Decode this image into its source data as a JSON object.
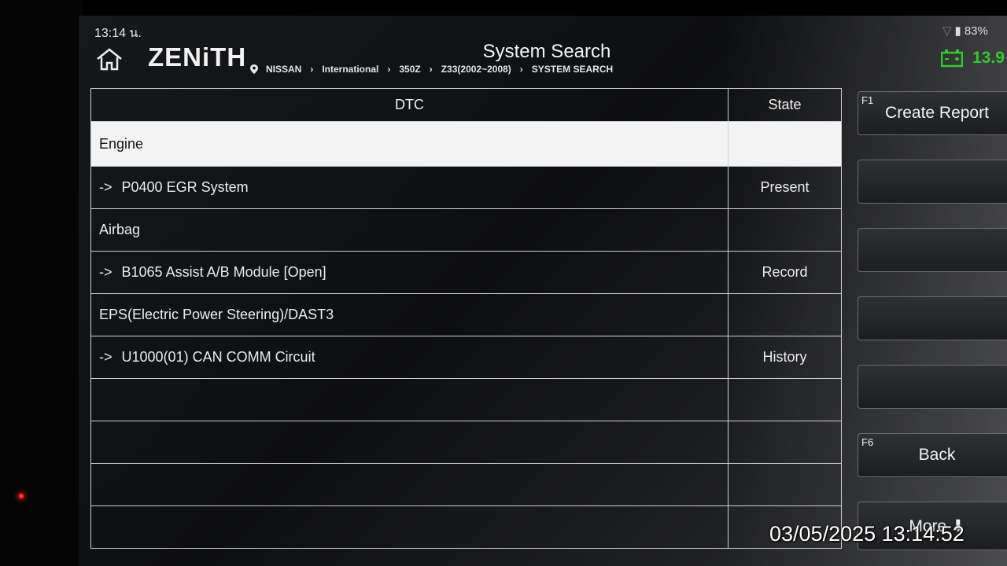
{
  "status": {
    "time": "13:14 น.",
    "battery": "83%"
  },
  "header": {
    "logo": "ZENiTH",
    "title": "System Search",
    "breadcrumb": [
      "NISSAN",
      "International",
      "350Z",
      "Z33(2002~2008)",
      "SYSTEM SEARCH"
    ],
    "voltage": "13.9"
  },
  "table": {
    "headers": {
      "dtc": "DTC",
      "state": "State"
    },
    "rows": [
      {
        "type": "group",
        "label": "Engine",
        "state": ""
      },
      {
        "type": "code",
        "label": "P0400 EGR System",
        "state": "Present"
      },
      {
        "type": "group",
        "label": "Airbag",
        "state": ""
      },
      {
        "type": "code",
        "label": "B1065 Assist A/B Module [Open]",
        "state": "Record"
      },
      {
        "type": "group",
        "label": "EPS(Electric Power Steering)/DAST3",
        "state": ""
      },
      {
        "type": "code",
        "label": "U1000(01) CAN COMM Circuit",
        "state": "History"
      }
    ],
    "arrow": "->"
  },
  "fkeys": {
    "f1": {
      "num": "F1",
      "label": "Create Report"
    },
    "f6": {
      "num": "F6",
      "label": "Back"
    },
    "more": {
      "label": "More ⬇"
    }
  },
  "overlay": {
    "timestamp": "03/05/2025 13:14:52"
  }
}
